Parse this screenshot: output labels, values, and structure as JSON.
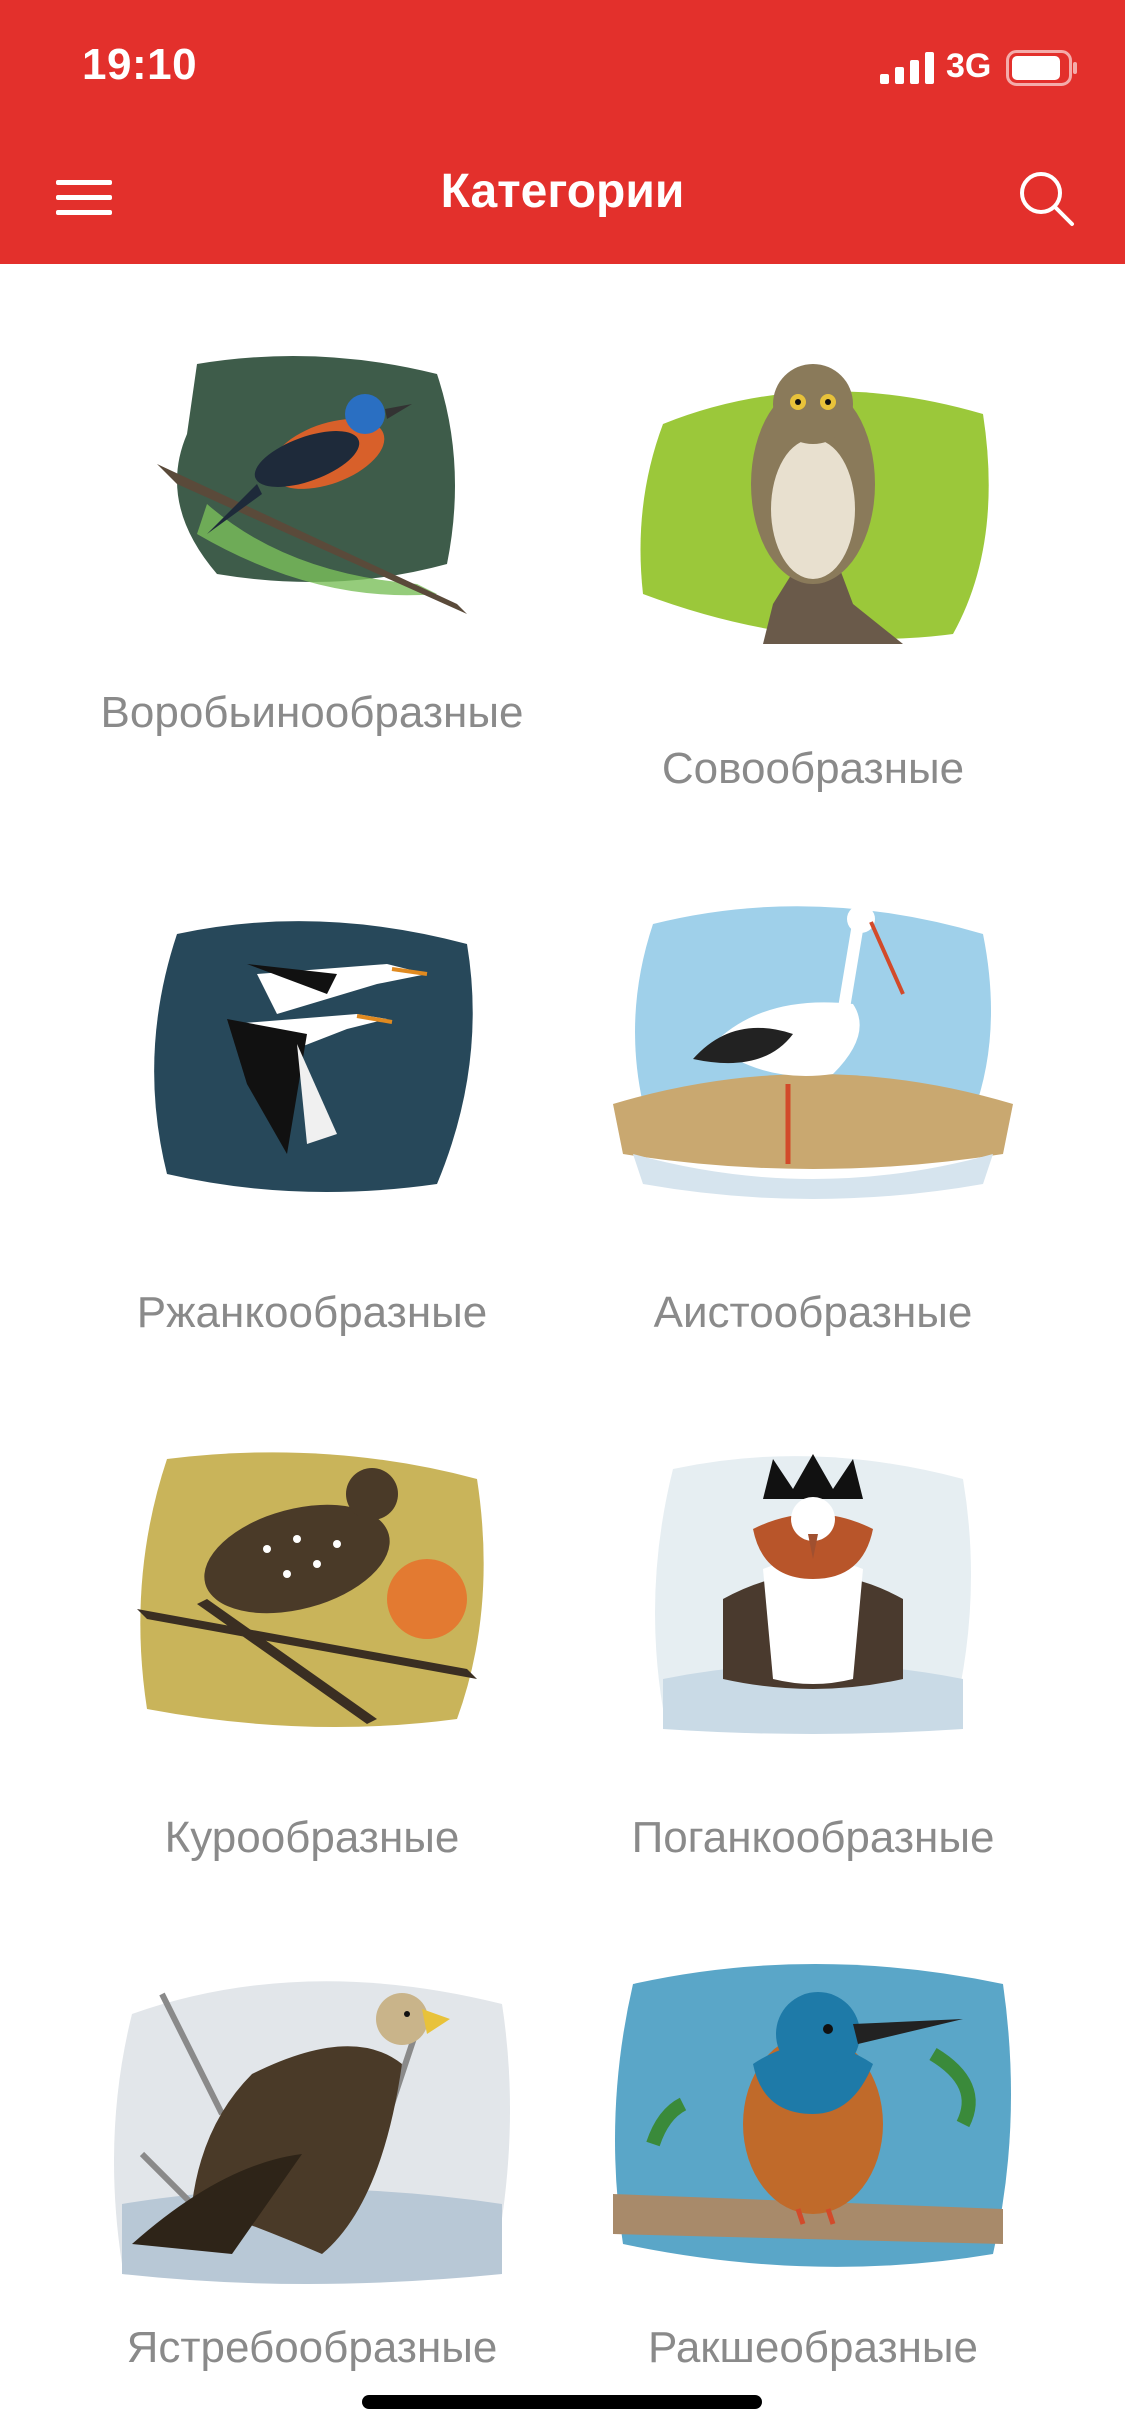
{
  "status_bar": {
    "time": "19:10",
    "network": "3G",
    "icons": [
      "signal-icon",
      "battery-icon"
    ]
  },
  "navbar": {
    "title": "Категории",
    "left_icon": "menu-icon",
    "right_icon": "search-icon"
  },
  "colors": {
    "header": "#e3302c",
    "label": "#8a8a8a",
    "background": "#ffffff"
  },
  "categories": [
    {
      "label": "Воробьинообразные",
      "image": "sparrow-illustration"
    },
    {
      "label": "Совообразные",
      "image": "owl-illustration"
    },
    {
      "label": "Ржанкообразные",
      "image": "oystercatcher-illustration"
    },
    {
      "label": "Аистообразные",
      "image": "stork-illustration"
    },
    {
      "label": "Курообразные",
      "image": "grouse-illustration"
    },
    {
      "label": "Поганкообразные",
      "image": "grebe-illustration"
    },
    {
      "label": "Ястребообразные",
      "image": "eagle-illustration"
    },
    {
      "label": "Ракшеобразные",
      "image": "kingfisher-illustration"
    }
  ]
}
